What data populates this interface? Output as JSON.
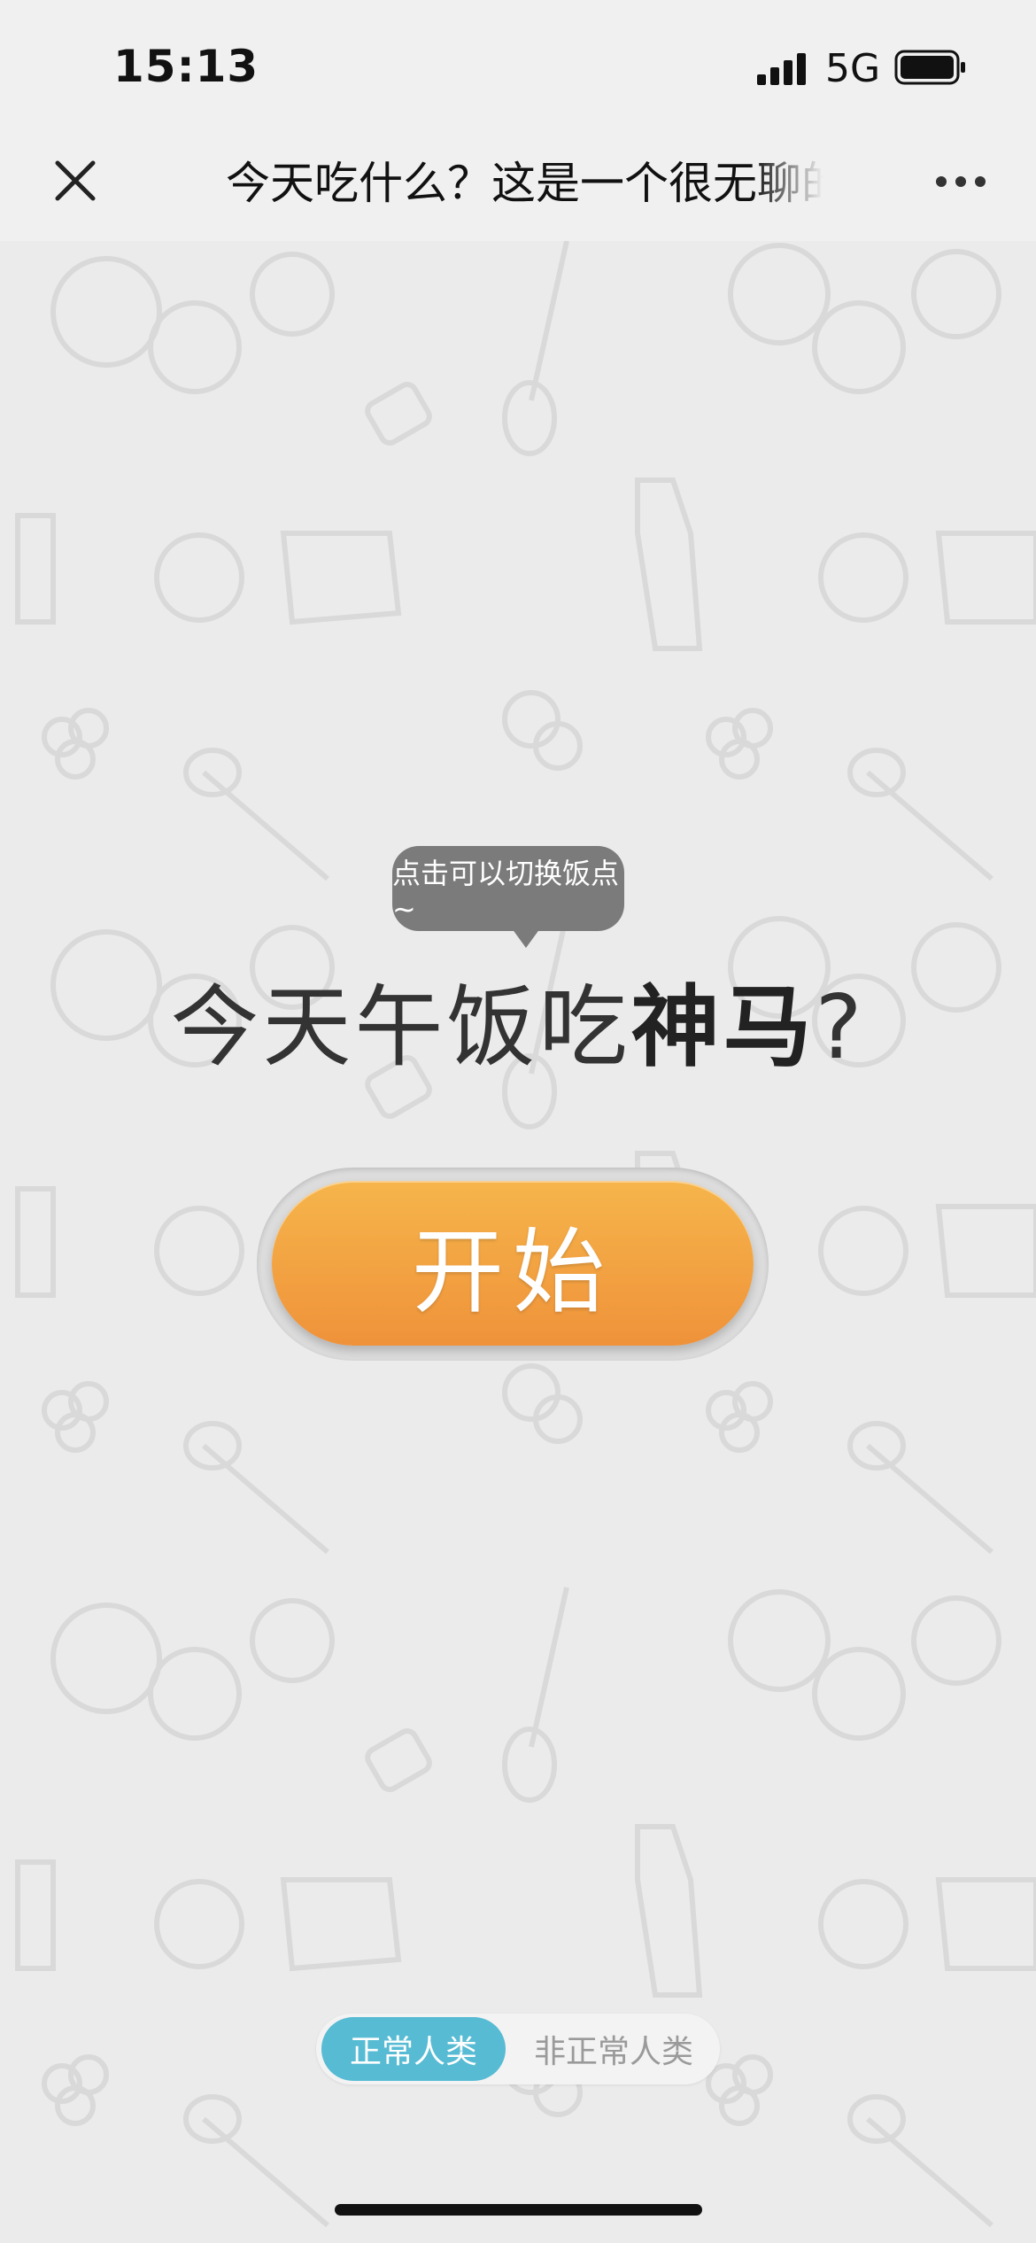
{
  "status_bar": {
    "time": "15:13",
    "network": "5G"
  },
  "nav": {
    "title": "今天吃什么？这是一个很无聊的小游戏"
  },
  "tooltip": {
    "text": "点击可以切换饭点~"
  },
  "headline": {
    "prefix": "今天",
    "meal": "午饭",
    "verb": "吃",
    "emphasis": "神马",
    "suffix": "?"
  },
  "start_button": {
    "label": "开始",
    "color_top": "#f6b54b",
    "color_bottom": "#ef923a"
  },
  "mode_switch": {
    "options": [
      {
        "label": "正常人类",
        "active": true
      },
      {
        "label": "非正常人类",
        "active": false
      }
    ],
    "active_color": "#56bbd3"
  }
}
